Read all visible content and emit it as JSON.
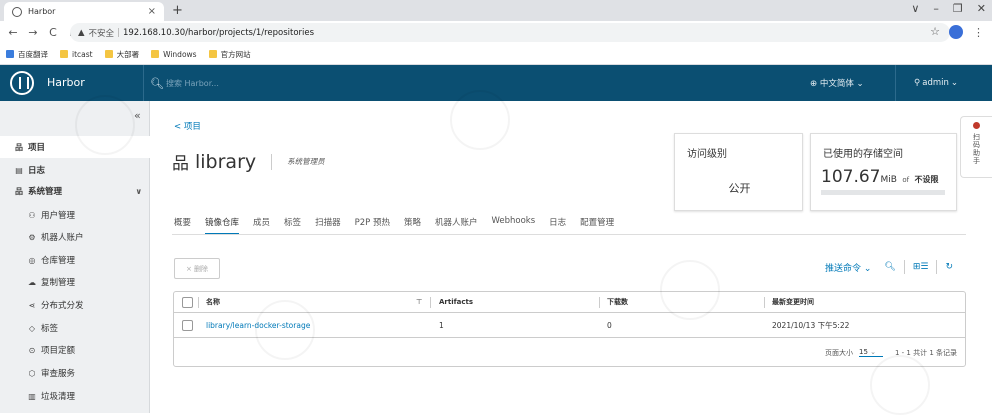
{
  "browser": {
    "tab_title": "Harbor",
    "tab_close": "×",
    "new_tab": "+",
    "win_min": "∨",
    "win_minimize": "–",
    "win_restore": "❐",
    "win_close": "✕",
    "back": "←",
    "forward": "→",
    "reload": "C",
    "home": "⌂",
    "security_warning": "▲",
    "insecure_label": "不安全",
    "separator": "|",
    "url": "192.168.10.30/harbor/projects/1/repositories",
    "star": "☆",
    "menu": "⋮",
    "bookmarks": [
      {
        "label": "百度翻译",
        "icon": "blue"
      },
      {
        "label": "itcast",
        "icon": "yellow"
      },
      {
        "label": "大部署",
        "icon": "yellow"
      },
      {
        "label": "Windows",
        "icon": "yellow"
      },
      {
        "label": "官方网站",
        "icon": "yellow"
      }
    ]
  },
  "header": {
    "brand": "Harbor",
    "search_icon": "🔍︎",
    "search_placeholder": "搜索 Harbor...",
    "language": "⊕ 中文简体 ⌄",
    "user": "admin",
    "user_icon": "⚲",
    "user_caret": "⌄",
    "colors": {
      "header_bg": "#0b4f72",
      "accent": "#0079b8"
    }
  },
  "sidebar": {
    "collapse": "«",
    "items": [
      {
        "label": "项目",
        "icon": "品",
        "active": true,
        "bold": true
      },
      {
        "label": "日志",
        "icon": "▤",
        "bold": true
      },
      {
        "label": "系统管理",
        "icon": "品",
        "bold": true,
        "caret": "∨"
      },
      {
        "label": "用户管理",
        "icon": "⚇"
      },
      {
        "label": "机器人账户",
        "icon": "⚙"
      },
      {
        "label": "仓库管理",
        "icon": "◎"
      },
      {
        "label": "复制管理",
        "icon": "☁"
      },
      {
        "label": "分布式分发",
        "icon": "⋖"
      },
      {
        "label": "标签",
        "icon": "◇"
      },
      {
        "label": "项目定额",
        "icon": "⊙"
      },
      {
        "label": "审查服务",
        "icon": "⬡"
      },
      {
        "label": "垃圾清理",
        "icon": "▥"
      }
    ]
  },
  "project": {
    "back_link": "< 项目",
    "icon": "品",
    "name": "library",
    "role": "系统管理员"
  },
  "cards": {
    "access": {
      "title": "访问级别",
      "value": "公开"
    },
    "storage": {
      "title": "已使用的存储空间",
      "value": "107.67",
      "unit": "MiB",
      "of": "of",
      "limit": "不设限",
      "fill_fraction": 0
    }
  },
  "tabs": [
    "概要",
    "镜像仓库",
    "成员",
    "标签",
    "扫描器",
    "P2P 预热",
    "策略",
    "机器人账户",
    "Webhooks",
    "日志",
    "配置管理"
  ],
  "active_tab": "镜像仓库",
  "toolbar": {
    "delete_label": "× 删除",
    "push_label": "推送命令 ⌄",
    "search_icon": "🔍︎",
    "view_icon": "⊞☰",
    "refresh_icon": "↻"
  },
  "table": {
    "columns": [
      "名称",
      "Artifacts",
      "下载数",
      "最新变更时间"
    ],
    "filter_icon": "⊤",
    "rows": [
      {
        "name": "library/learn-docker-storage",
        "artifacts": "1",
        "downloads": "0",
        "updated": "2021/10/13 下午5:22"
      }
    ],
    "footer": {
      "page_size_label": "页面大小",
      "page_size": "15",
      "page_size_caret": "⌄",
      "summary": "1 - 1 共计 1 条记录"
    }
  },
  "side_widget": {
    "text": "扫码助手"
  }
}
